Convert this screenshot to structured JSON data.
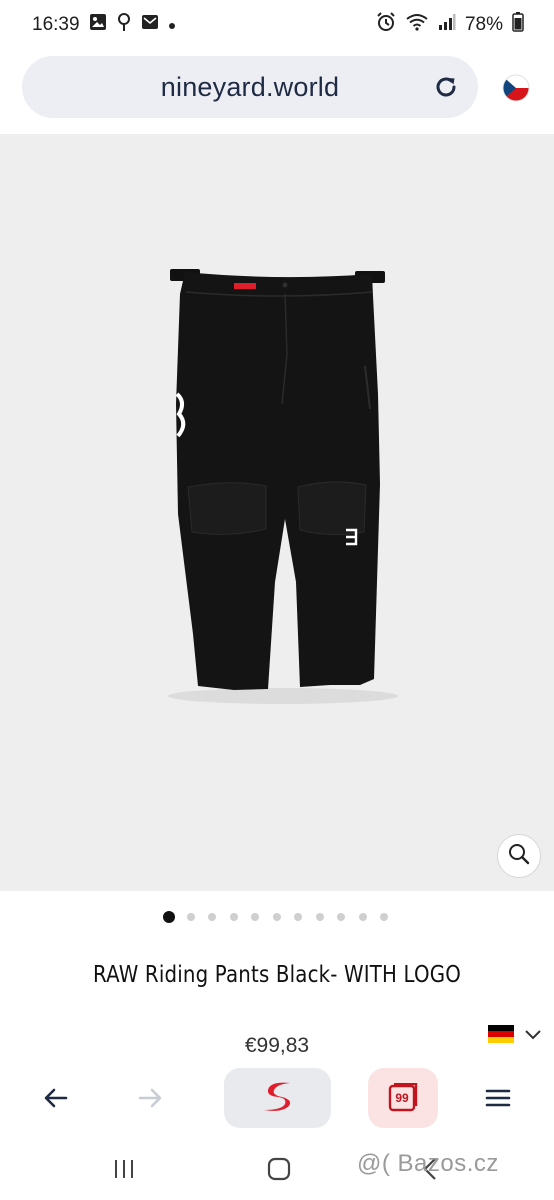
{
  "status_bar": {
    "time": "16:39",
    "battery": "78%",
    "icons": [
      "image-icon",
      "location-icon",
      "mail-icon",
      "dot-icon",
      "alarm-icon",
      "wifi-icon",
      "signal-icon",
      "battery-icon"
    ]
  },
  "browser": {
    "url": "nineyard.world",
    "reload_icon": "reload-icon",
    "flag_icon": "czech-flag-icon"
  },
  "product": {
    "title": "RAW Riding Pants Black- WITH LOGO",
    "price": "€99,83",
    "image_count": 11,
    "active_image": 1,
    "zoom_icon": "magnifier-icon",
    "language_flag_icon": "german-flag-icon"
  },
  "bottom_bar": {
    "icons": [
      "back-arrow-icon",
      "forward-arrow-icon",
      "s-logo-icon",
      "tabs-icon",
      "menu-icon"
    ],
    "tabs_count": "99"
  },
  "android_nav": {
    "icons": [
      "recents-icon",
      "home-icon",
      "back-icon"
    ]
  },
  "watermark": "@( Bazos.cz",
  "colors": {
    "hero_background": "#eeeeee",
    "accent_red": "#e01e2b",
    "url_bar": "#eceef3"
  }
}
